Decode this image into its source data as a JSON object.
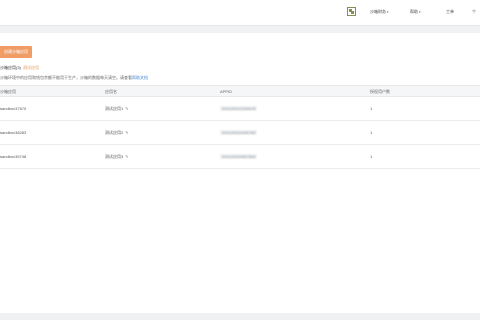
{
  "topbar": {
    "qr_icon": "qr-code-icon",
    "nav": [
      {
        "label": "沙箱财务",
        "has_dropdown": true
      },
      {
        "label": "帮助",
        "has_dropdown": true
      },
      {
        "label": "工单",
        "has_dropdown": false
      },
      {
        "label": "个",
        "has_dropdown": false
      }
    ]
  },
  "main": {
    "create_button": "创建沙箱应用",
    "tabs": [
      {
        "label": "沙箱应用(3)",
        "active": true
      },
      {
        "label": "测试应用",
        "active": false
      }
    ],
    "notice": {
      "text": "沙箱环境中的应用和钱包余额不能用于生产，沙箱的数据每天清空。请查看",
      "link": "帮助文档"
    },
    "table": {
      "columns": [
        "沙箱应用",
        "应用名",
        "APPID",
        "授权用户数"
      ],
      "rows": [
        {
          "sandbox": "sandbox37670",
          "name": "测试应用1",
          "appid": "202100012345678",
          "users": "1"
        },
        {
          "sandbox": "sandbox38283",
          "name": "测试应用2",
          "appid": "202100023456789",
          "users": "1"
        },
        {
          "sandbox": "sandbox35748",
          "name": "测试应用3",
          "appid": "202100034567890",
          "users": "1"
        }
      ]
    }
  },
  "colors": {
    "accent": "#f09c65",
    "link": "#3b83d6",
    "tab_inactive": "#e49a5a"
  }
}
